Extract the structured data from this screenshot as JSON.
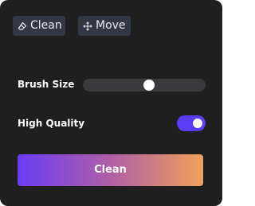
{
  "toolbar": {
    "clean_label": "Clean",
    "clean_icon": "eraser-icon",
    "move_label": "Move",
    "move_icon": "move-arrows-icon"
  },
  "brush": {
    "label": "Brush Size",
    "value_fraction": 0.54
  },
  "quality": {
    "label": "High Quality",
    "enabled": true
  },
  "action": {
    "clean_label": "Clean"
  },
  "colors": {
    "panel_bg": "#1f1f20",
    "button_bg": "#313844",
    "toggle_on": "#5b3cf5",
    "gradient_start": "#6b3cf3",
    "gradient_end": "#f0a05a"
  }
}
